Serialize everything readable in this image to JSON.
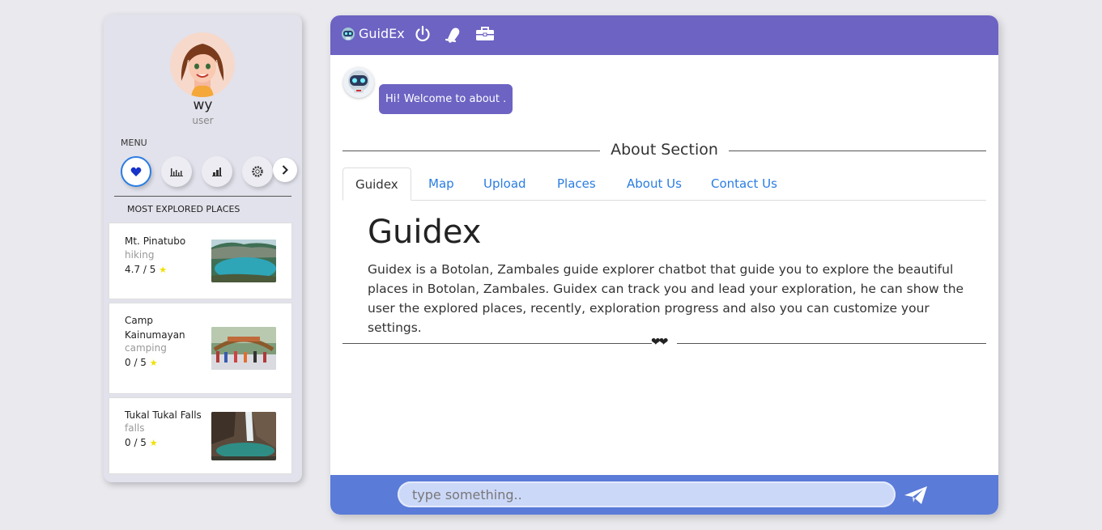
{
  "sidebar": {
    "username": "wy",
    "role": "user",
    "menu_label": "MENU",
    "menu_icons": [
      "heart-icon",
      "bar-chart-icon",
      "signal-icon",
      "settings-icon",
      "chevron-right-icon"
    ],
    "most_explored_label": "MOST EXPLORED PLACES",
    "places": [
      {
        "name": "Mt. Pinatubo",
        "category": "hiking",
        "rating": "4.7 / 5"
      },
      {
        "name": "Camp Kainumayan",
        "category": "camping",
        "rating": "0 / 5"
      },
      {
        "name": "Tukal Tukal Falls",
        "category": "falls",
        "rating": "0 / 5"
      }
    ]
  },
  "topbar": {
    "brand": "GuidEx",
    "icons": [
      "power-icon",
      "notification-icon",
      "briefcase-icon"
    ]
  },
  "chat": {
    "welcome": "Hi! Welcome to about ."
  },
  "about": {
    "section_title": "About Section",
    "tabs": [
      "Guidex",
      "Map",
      "Upload",
      "Places",
      "About Us",
      "Contact Us"
    ],
    "active_tab": "Guidex",
    "content_title": "Guidex",
    "content_text": "Guidex is a Botolan, Zambales guide explorer chatbot that guide you to explore the beautiful places in Botolan, Zambales. Guidex can track you and lead your exploration, he can show the user the explored places, recently, exploration progress and also you can customize your settings.",
    "divider_glyph": "❤❤"
  },
  "input": {
    "placeholder": "type something.."
  },
  "colors": {
    "topbar": "#6c63c3",
    "inputbar": "#5a7bd8",
    "link": "#2a7de1"
  }
}
